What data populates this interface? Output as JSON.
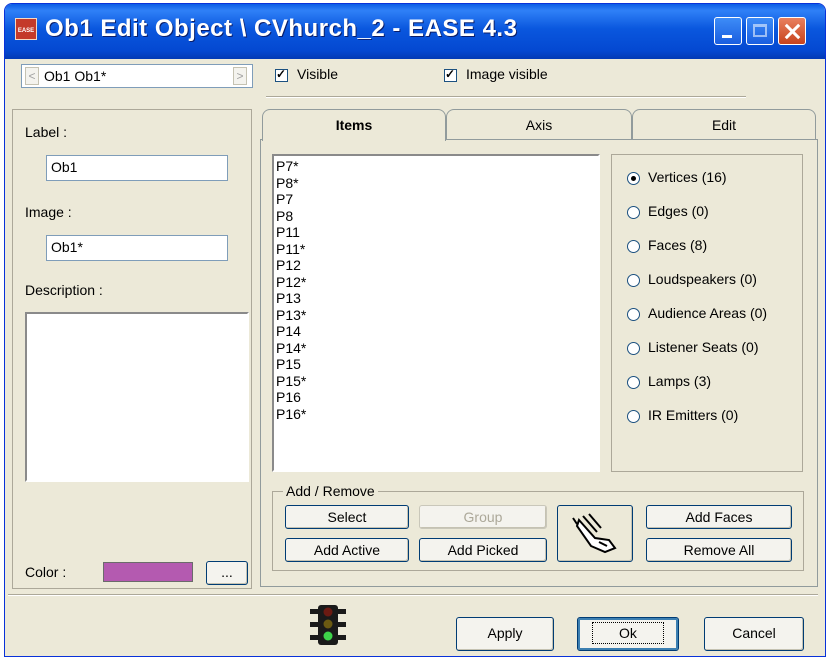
{
  "window": {
    "title": "Ob1 Edit Object \\ CVhurch_2 - EASE 4.3",
    "app_icon_text": "EASE"
  },
  "toolbar": {
    "object_selector_value": "Ob1 Ob1*",
    "visible_label": "Visible",
    "image_visible_label": "Image visible"
  },
  "left": {
    "label_caption": "Label :",
    "label_value": "Ob1",
    "image_caption": "Image :",
    "image_value": "Ob1*",
    "description_caption": "Description :",
    "color_caption": "Color :",
    "color_value": "#b45ab0",
    "color_button": "..."
  },
  "tabs": [
    "Items",
    "Axis",
    "Edit"
  ],
  "items_list": [
    "P7*",
    "P8*",
    "P7",
    "P8",
    "P11",
    "P11*",
    "P12",
    "P12*",
    "P13",
    "P13*",
    "P14",
    "P14*",
    "P15",
    "P15*",
    "P16",
    "P16*"
  ],
  "item_types": [
    {
      "label": "Vertices (16)",
      "selected": true
    },
    {
      "label": "Edges (0)",
      "selected": false
    },
    {
      "label": "Faces (8)",
      "selected": false
    },
    {
      "label": "Loudspeakers (0)",
      "selected": false
    },
    {
      "label": "Audience Areas (0)",
      "selected": false
    },
    {
      "label": "Listener Seats (0)",
      "selected": false
    },
    {
      "label": "Lamps (3)",
      "selected": false
    },
    {
      "label": "IR Emitters (0)",
      "selected": false
    }
  ],
  "add_remove": {
    "caption": "Add / Remove",
    "select": "Select",
    "group": "Group",
    "add_active": "Add Active",
    "add_picked": "Add Picked",
    "add_faces": "Add Faces",
    "remove_all": "Remove All"
  },
  "footer": {
    "apply": "Apply",
    "ok": "Ok",
    "cancel": "Cancel"
  },
  "icons": [
    "app-icon",
    "pick-hand-icon",
    "traffic-light-icon",
    "minimize-icon",
    "maximize-icon",
    "close-icon"
  ]
}
